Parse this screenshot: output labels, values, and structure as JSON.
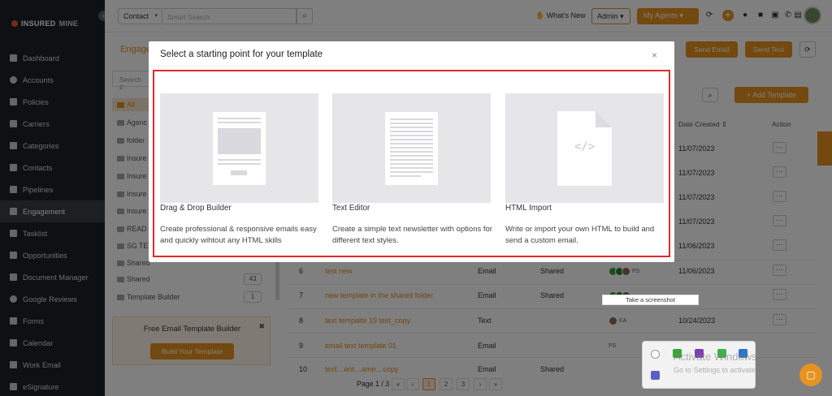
{
  "sidebar": {
    "brand_prefix": "I",
    "brand_a": "INSURED",
    "brand_b": "MINE",
    "collapse_icon": "‹",
    "items": [
      {
        "label": "Dashboard"
      },
      {
        "label": "Accounts"
      },
      {
        "label": "Policies"
      },
      {
        "label": "Carriers"
      },
      {
        "label": "Categories"
      },
      {
        "label": "Contacts"
      },
      {
        "label": "Pipelines"
      },
      {
        "label": "Engagement",
        "active": true
      },
      {
        "label": "Tasklist"
      },
      {
        "label": "Opportunities"
      },
      {
        "label": "Document Manager"
      },
      {
        "label": "Google Reviews"
      },
      {
        "label": "Forms"
      },
      {
        "label": "Calendar"
      },
      {
        "label": "Work Email"
      },
      {
        "label": "eSignature"
      }
    ]
  },
  "topbar": {
    "contact_dd": "Contact",
    "search_placeholder": "Smart Search",
    "whats_new": "What's New",
    "admin_dd": "Admin",
    "my_agents": "My Agents"
  },
  "page": {
    "title": "Engage",
    "send_email": "Send Email",
    "send_text": "Send Text",
    "folder_search_placeholder": "Search F",
    "folders": [
      {
        "label": "All",
        "active": true
      },
      {
        "label": "Agenc"
      },
      {
        "label": "folder"
      },
      {
        "label": "Insure"
      },
      {
        "label": "Insure"
      },
      {
        "label": "Insure"
      },
      {
        "label": "Insure"
      },
      {
        "label": "READ"
      },
      {
        "label": "SG TE"
      },
      {
        "label": "Shared"
      },
      {
        "label": "Shared",
        "count": "43"
      },
      {
        "label": "Template Builder",
        "count": "1"
      }
    ],
    "promo_title": "Free Email Template Builder",
    "promo_button": "Build Your Template",
    "add_template": "+ Add Template",
    "col_date": "Date Created ⇕",
    "col_action": "Action",
    "dates_top": [
      "11/07/2023",
      "11/07/2023",
      "11/07/2023",
      "11/07/2023",
      "11/06/2023"
    ],
    "rows": [
      {
        "num": "6",
        "name": "test new",
        "type": "Email",
        "shared": "Shared",
        "users": "PS",
        "date": "11/06/2023"
      },
      {
        "num": "7",
        "name": "new template in the shared folder",
        "type": "Email",
        "shared": "Shared",
        "users": "",
        "date": "11/06/2023"
      },
      {
        "num": "8",
        "name": "text tempalte 19 test_copy",
        "type": "Text",
        "shared": "",
        "users": "KA",
        "date": "10/24/2023"
      },
      {
        "num": "9",
        "name": "email text template 01",
        "type": "Email",
        "shared": "",
        "users": "PS",
        "date": ""
      },
      {
        "num": "10",
        "name": "test…ent…ame…copy",
        "type": "Email",
        "shared": "Shared",
        "users": "",
        "date": ""
      }
    ],
    "pager_label": "Page 1 / 3",
    "pages": [
      "«",
      "‹",
      "1",
      "2",
      "3",
      "›",
      "»"
    ]
  },
  "tooltip": "Take a screenshot",
  "watermark_title": "Activate Windows",
  "watermark_sub": "Go to Settings to activate Windows.",
  "modal": {
    "title": "Select a starting point for your template",
    "close": "×",
    "cards": [
      {
        "title": "Drag & Drop Builder",
        "desc": "Create professional & responsive emails easy and quickly wihtout any HTML skills"
      },
      {
        "title": "Text Editor",
        "desc": "Create a simple text newsletter with options for different text styles."
      },
      {
        "title": "HTML Import",
        "desc": "Write or import your own HTML to build and send a custom email."
      }
    ],
    "code_glyph": "</>"
  },
  "colors": {
    "accent": "#e7931f",
    "highlight": "#e3282e",
    "sidebar": "#1e2127"
  }
}
